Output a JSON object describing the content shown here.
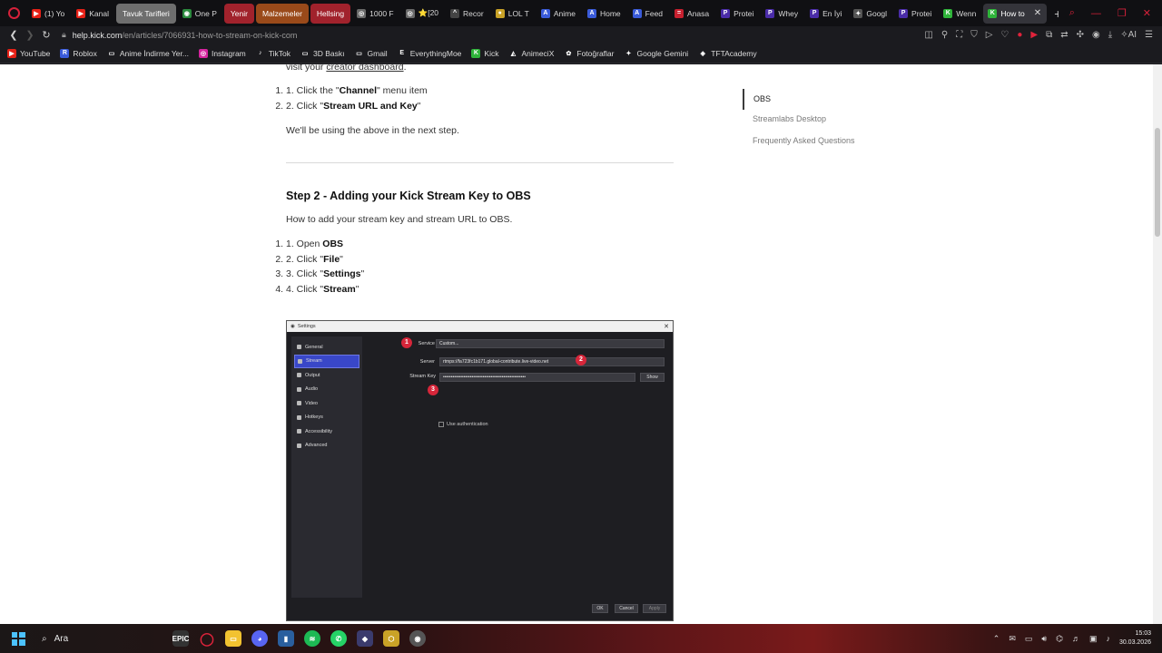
{
  "tabs": [
    {
      "label": "(1) Yo",
      "fav": "▶",
      "color": "#e62117"
    },
    {
      "label": "Kanal",
      "fav": "▶",
      "color": "#e62117"
    },
    {
      "label": "Tavuk Tarifleri",
      "group": "gray"
    },
    {
      "label": "One P",
      "fav": "◉",
      "color": "#2b8a3e"
    },
    {
      "label": "Yenir",
      "group": "red2"
    },
    {
      "label": "Malzemeler",
      "group": "orange"
    },
    {
      "label": "Hellsing",
      "group": "red2"
    },
    {
      "label": "1000 F",
      "fav": "◎",
      "color": "#6a6a6a"
    },
    {
      "label": "⭐[20",
      "fav": "◎",
      "color": "#6a6a6a"
    },
    {
      "label": "Recor",
      "fav": "^",
      "color": "#444"
    },
    {
      "label": "LOL T",
      "fav": "●",
      "color": "#c9a227"
    },
    {
      "label": "Anime",
      "fav": "A",
      "color": "#3a5bd9"
    },
    {
      "label": "Home",
      "fav": "A",
      "color": "#3a5bd9"
    },
    {
      "label": "Feed",
      "fav": "A",
      "color": "#3a5bd9"
    },
    {
      "label": "Anasa",
      "fav": "=",
      "color": "#c7202f"
    },
    {
      "label": "Protei",
      "fav": "P",
      "color": "#4a2ca8"
    },
    {
      "label": "Whey",
      "fav": "P",
      "color": "#4a2ca8"
    },
    {
      "label": "En İyi",
      "fav": "P",
      "color": "#4a2ca8"
    },
    {
      "label": "Googl",
      "fav": "✦",
      "color": "#555"
    },
    {
      "label": "Protei",
      "fav": "P",
      "color": "#4a2ca8"
    },
    {
      "label": "Wenn",
      "fav": "K",
      "color": "#2fb43a"
    },
    {
      "label": "How to",
      "fav": "K",
      "color": "#2fb43a",
      "active": true
    }
  ],
  "address": {
    "host": "help.kick.com",
    "path": "/en/articles/7066931-how-to-stream-on-kick-com"
  },
  "bookmarks": [
    {
      "label": "YouTube",
      "icon": "youtube-icon",
      "glyph": "▶",
      "color": "#e62117"
    },
    {
      "label": "Roblox",
      "icon": "roblox-icon",
      "glyph": "R",
      "color": "#3a5bd9"
    },
    {
      "label": "Anime İndirme Yer...",
      "icon": "folder-icon",
      "glyph": "▭",
      "color": "transparent"
    },
    {
      "label": "Instagram",
      "icon": "instagram-icon",
      "glyph": "◎",
      "color": "#d6249f"
    },
    {
      "label": "TikTok",
      "icon": "tiktok-icon",
      "glyph": "♪",
      "color": "transparent"
    },
    {
      "label": "3D Baskı",
      "icon": "folder-icon",
      "glyph": "▭",
      "color": "transparent"
    },
    {
      "label": "Gmail",
      "icon": "folder-icon",
      "glyph": "▭",
      "color": "transparent"
    },
    {
      "label": "EverythingMoe",
      "icon": "everythingmoe-icon",
      "glyph": "E",
      "color": "transparent"
    },
    {
      "label": "Kick",
      "icon": "kick-icon",
      "glyph": "K",
      "color": "#2fb43a"
    },
    {
      "label": "AnimeciX",
      "icon": "animecix-icon",
      "glyph": "◭",
      "color": "transparent"
    },
    {
      "label": "Fotoğraflar",
      "icon": "photos-icon",
      "glyph": "✿",
      "color": "transparent"
    },
    {
      "label": "Google Gemini",
      "icon": "gemini-icon",
      "glyph": "✦",
      "color": "transparent"
    },
    {
      "label": "TFTAcademy",
      "icon": "tftacademy-icon",
      "glyph": "◈",
      "color": "transparent"
    }
  ],
  "article": {
    "visit_prefix": "visit your ",
    "visit_link": "creator dashboard",
    "visit_suffix": ".",
    "step1": [
      {
        "pre": "1. Click the \"",
        "bold": "Channel",
        "post": "\" menu item"
      },
      {
        "pre": "2. Click \"",
        "bold": "Stream URL and Key",
        "post": "\""
      }
    ],
    "using_text": "We'll be using the above in the next step.",
    "step2_heading": "Step 2 - Adding your Kick Stream Key to OBS",
    "step2_intro": "How to add your stream key and stream URL to OBS.",
    "step2": [
      {
        "pre": "1. Open ",
        "bold": "OBS",
        "post": ""
      },
      {
        "pre": "2. Click \"",
        "bold": "File",
        "post": "\""
      },
      {
        "pre": "3. Click \"",
        "bold": "Settings",
        "post": "\""
      },
      {
        "pre": "4. Click \"",
        "bold": "Stream",
        "post": "\""
      }
    ]
  },
  "toc": {
    "active": "OBS",
    "items": [
      "Streamlabs Desktop",
      "Frequently Asked Questions"
    ]
  },
  "obs": {
    "window_title": "Settings",
    "sidebar": [
      "General",
      "Stream",
      "Output",
      "Audio",
      "Video",
      "Hotkeys",
      "Accessibility",
      "Advanced"
    ],
    "selected": "Stream",
    "service_label": "Service",
    "service_value": "Custom...",
    "server_label": "Server",
    "server_value": "rtmps://fa723fc1b171.global-contribute.live-video.net",
    "key_label": "Stream Key",
    "key_value": "••••••••••••••••••••••••••••••••••••••••••••••••••••",
    "show_btn": "Show",
    "use_auth": "Use authentication",
    "markers": [
      "1",
      "2",
      "3"
    ],
    "ok": "OK",
    "cancel": "Cancel",
    "apply": "Apply"
  },
  "taskbar": {
    "search": "Ara",
    "time": "15:03",
    "date": "30.03.2026"
  }
}
